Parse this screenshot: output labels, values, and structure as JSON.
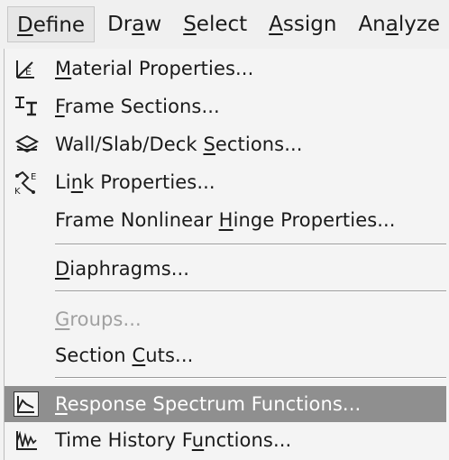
{
  "menubar": {
    "items": [
      {
        "label_pre": "",
        "label_key": "D",
        "label_post": "efine"
      },
      {
        "label_pre": "Dr",
        "label_key": "a",
        "label_post": "w"
      },
      {
        "label_pre": "",
        "label_key": "S",
        "label_post": "elect"
      },
      {
        "label_pre": "",
        "label_key": "A",
        "label_post": "ssign"
      },
      {
        "label_pre": "An",
        "label_key": "a",
        "label_post": "lyze"
      }
    ]
  },
  "menu": {
    "items": [
      {
        "pre": "",
        "key": "M",
        "post": "aterial Properties...",
        "icon": "material-properties-icon"
      },
      {
        "pre": "",
        "key": "F",
        "post": "rame Sections...",
        "icon": "frame-sections-icon"
      },
      {
        "pre": "Wall/Slab/Deck ",
        "key": "S",
        "post": "ections...",
        "icon": "wall-slab-deck-icon"
      },
      {
        "pre": "Li",
        "key": "n",
        "post": "k Properties...",
        "icon": "link-properties-icon"
      },
      {
        "pre": "Frame Nonlinear ",
        "key": "H",
        "post": "inge Properties..."
      },
      {
        "pre": "",
        "key": "D",
        "post": "iaphragms..."
      },
      {
        "pre": "",
        "key": "G",
        "post": "roups...",
        "disabled": true
      },
      {
        "pre": "Section ",
        "key": "C",
        "post": "uts..."
      },
      {
        "pre": "",
        "key": "R",
        "post": "esponse Spectrum Functions...",
        "icon": "response-spectrum-icon",
        "highlighted": true
      },
      {
        "pre": "Time History F",
        "key": "u",
        "post": "nctions...",
        "icon": "time-history-icon"
      }
    ]
  },
  "colors": {
    "highlight": "#8f8f8f",
    "disabled_text": "#a0a0a0"
  }
}
